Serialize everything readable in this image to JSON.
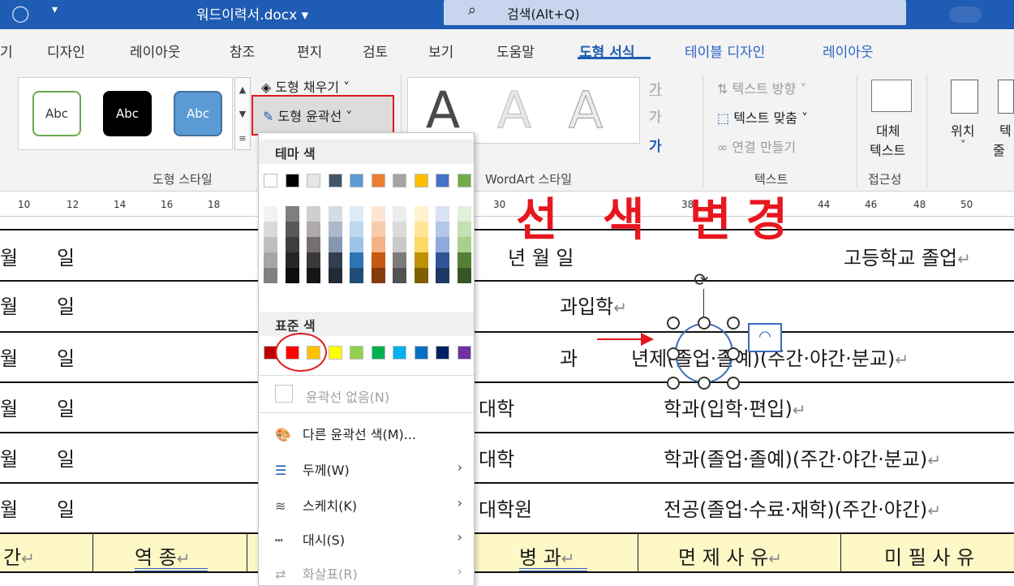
{
  "titlebar": {
    "quick_access": "▾",
    "document_name": "워드이력서.docx ▾",
    "search_placeholder": "검색(Alt+Q)"
  },
  "tabs": [
    {
      "label": "기"
    },
    {
      "label": "디자인"
    },
    {
      "label": "레이아웃"
    },
    {
      "label": "참조"
    },
    {
      "label": "편지"
    },
    {
      "label": "검토"
    },
    {
      "label": "보기"
    },
    {
      "label": "도움말"
    },
    {
      "label": "도형 서식"
    },
    {
      "label": "테이블 디자인"
    },
    {
      "label": "레이아웃"
    }
  ],
  "ribbon": {
    "shape_style_sample": "Abc",
    "shape_styles_group": "도형 스타일",
    "fill_btn": "도형 채우기 ˅",
    "outline_btn": "도형 윤곽선 ˅",
    "wordart_sample": "A",
    "wordart_group": "WordArt 스타일",
    "text_fill_glyph": "가",
    "text_outline_glyph": "가",
    "text_effect_glyph": "가",
    "text_direction": "텍스트 방향 ˅",
    "text_align": "텍스트 맞춤 ˅",
    "create_link": "연결 만들기",
    "text_group": "텍스트",
    "alt_text_line1": "대체",
    "alt_text_line2": "텍스트",
    "accessibility_group": "접근성",
    "position": "위치",
    "wrap_partial": "텍",
    "wrap_partial2": "줄"
  },
  "ruler": [
    "10",
    "12",
    "14",
    "16",
    "18",
    "30",
    "38",
    "44",
    "46",
    "48",
    "50"
  ],
  "overlay_title": "선 색 변경",
  "doc": {
    "rows": [
      {
        "left_a": "월",
        "left_b": "일",
        "mid": "년    월    일",
        "right": "고등학교 졸업"
      },
      {
        "left_a": "월",
        "left_b": "일",
        "mid": "과입학",
        "right": ""
      },
      {
        "left_a": "월",
        "left_b": "일",
        "mid": "과",
        "right": "년제(졸업·졸예)(주간·야간·분교)"
      },
      {
        "left_a": "월",
        "left_b": "일",
        "mid": "대학",
        "right": "학과(입학·편입)"
      },
      {
        "left_a": "월",
        "left_b": "일",
        "mid": "대학",
        "right": "학과(졸업·졸예)(주간·야간·분교)"
      },
      {
        "left_a": "월",
        "left_b": "일",
        "mid": "대학원",
        "right": "전공(졸업·수료·재학)(주간·야간)"
      }
    ],
    "header_row": {
      "c1": "간",
      "c2": "역  종",
      "c3": "병  과",
      "c4": "면 제 사 유",
      "c5": "미 필 사 유"
    },
    "para_mark": "↵"
  },
  "menu": {
    "theme_colors_label": "테마 색",
    "standard_colors_label": "표준 색",
    "no_outline": "윤곽선 없음(N)",
    "more_colors": "다른 윤곽선 색(M)...",
    "weight": "두께(W)",
    "sketch": "스케치(K)",
    "dashes": "대시(S)",
    "arrows": "화살표(R)",
    "theme_colors": [
      "#ffffff",
      "#000000",
      "#e7e6e6",
      "#44546a",
      "#5b9bd5",
      "#ed7d31",
      "#a5a5a5",
      "#ffc000",
      "#4472c4",
      "#70ad47"
    ],
    "standard_colors": [
      "#c00000",
      "#ff0000",
      "#ffc000",
      "#ffff00",
      "#92d050",
      "#00b050",
      "#00b0f0",
      "#0070c0",
      "#002060",
      "#7030a0"
    ],
    "shade_columns": [
      [
        "#f2f2f2",
        "#d9d9d9",
        "#bfbfbf",
        "#a6a6a6",
        "#808080"
      ],
      [
        "#7f7f7f",
        "#595959",
        "#3f3f3f",
        "#262626",
        "#0d0d0d"
      ],
      [
        "#d0cece",
        "#aeaaaa",
        "#757070",
        "#3a3838",
        "#171616"
      ],
      [
        "#d6dce4",
        "#adb9ca",
        "#8496b0",
        "#323f4f",
        "#222a35"
      ],
      [
        "#deebf6",
        "#bdd7ee",
        "#9dc3e6",
        "#2e75b5",
        "#1e4e79"
      ],
      [
        "#fbe5d5",
        "#f7cbac",
        "#f4b183",
        "#c55a11",
        "#833c0b"
      ],
      [
        "#ededed",
        "#dbdbdb",
        "#c9c9c9",
        "#7b7b7b",
        "#525252"
      ],
      [
        "#fff2cc",
        "#ffe699",
        "#ffd966",
        "#bf9000",
        "#7f6000"
      ],
      [
        "#dae3f3",
        "#b4c7e7",
        "#8faadc",
        "#2f5597",
        "#1f3864"
      ],
      [
        "#e2efd9",
        "#c5e0b3",
        "#a8d08d",
        "#538135",
        "#375623"
      ]
    ]
  },
  "colors": {
    "accent": "#1f5cb3",
    "highlight_red": "#e0181e"
  }
}
